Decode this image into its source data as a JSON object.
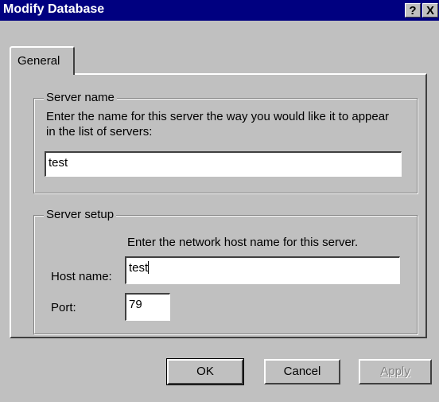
{
  "window": {
    "title": "Modify Database",
    "help_label": "?",
    "close_label": "X"
  },
  "tabs": [
    {
      "label": "General",
      "selected": true
    }
  ],
  "server_name_group": {
    "title": "Server name",
    "instruction_line1": "Enter the name for this server the way you would like it to appear",
    "instruction_line2": "in the list of servers:",
    "value": "test"
  },
  "server_setup_group": {
    "title": "Server setup",
    "instruction": "Enter the network host name for this server.",
    "host_label": "Host name:",
    "host_value": "test",
    "port_label": "Port:",
    "port_value": "79"
  },
  "buttons": {
    "ok": "OK",
    "cancel": "Cancel",
    "apply": "Apply"
  }
}
